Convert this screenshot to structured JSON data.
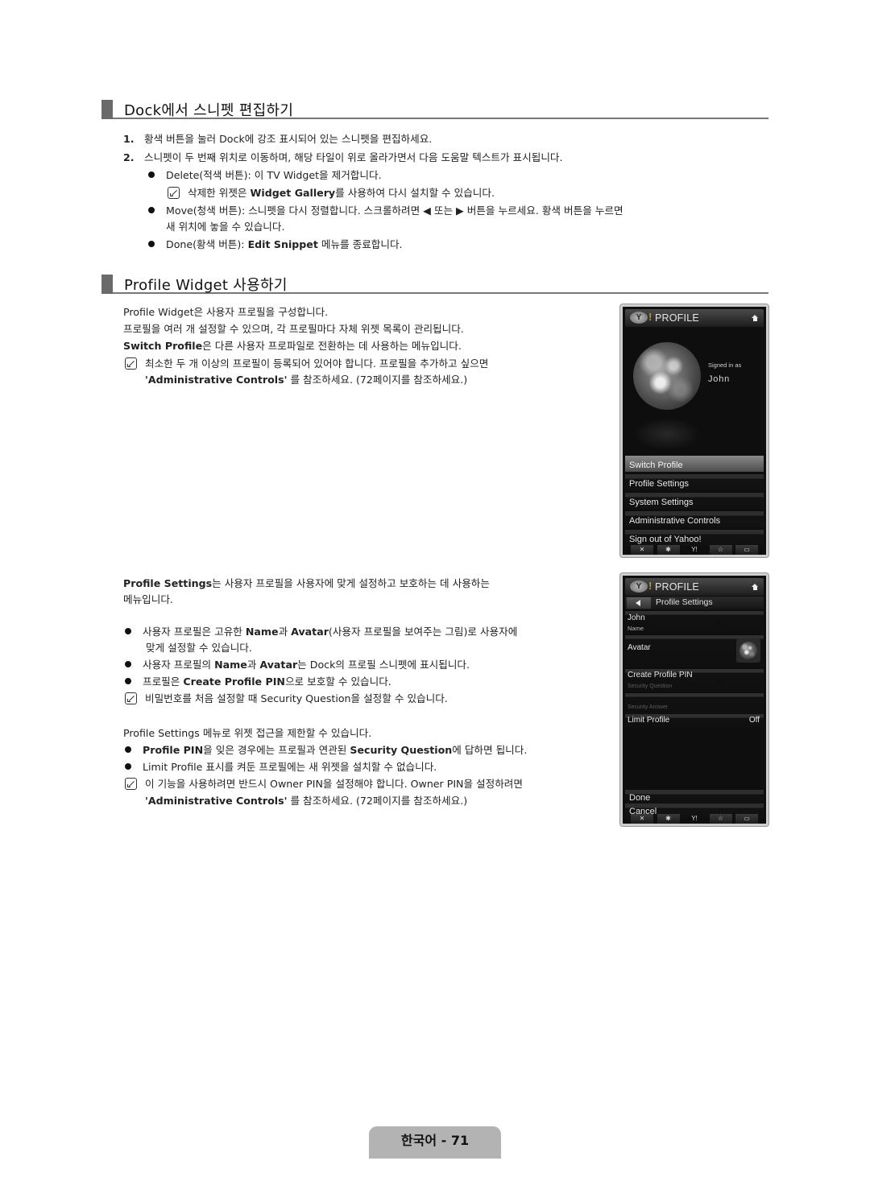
{
  "section1": {
    "title": "Dock에서 스니펫 편집하기",
    "steps": [
      {
        "num": "1.",
        "text": "황색 버튼을 눌러 Dock에 강조 표시되어 있는 스니펫을 편집하세요."
      },
      {
        "num": "2.",
        "text": "스니펫이 두 번째 위치로 이동하며, 해당 타일이 위로 올라가면서 다음 도움말 텍스트가 표시됩니다."
      }
    ],
    "bullets": {
      "delete_pre": "Delete(적색 버튼): 이 TV Widget을 제거합니다.",
      "delete_note_a": "삭제한 위젯은 ",
      "delete_note_b": "Widget Gallery",
      "delete_note_c": "를 사용하여 다시 설치할 수 있습니다.",
      "move_line1": "Move(청색 버튼): 스니펫을 다시 정렬합니다. 스크롤하려면 ◀ 또는 ▶ 버튼을 누르세요. 황색 버튼을 누르면",
      "move_line2": "새 위치에 놓을 수 있습니다.",
      "done_a": "Done(황색 버튼): ",
      "done_b": "Edit Snippet",
      "done_c": " 메뉴를 종료합니다."
    }
  },
  "section2": {
    "title": "Profile Widget 사용하기",
    "intro1": "Profile Widget은 사용자 프로필을 구성합니다.",
    "intro2": "프로필을 여러 개 설정할 수 있으며, 각 프로필마다 자체 위젯 목록이 관리됩니다.",
    "intro3_b": "Switch Profile",
    "intro3_c": "은 다른 사용자 프로파일로 전환하는 데 사용하는 메뉴입니다.",
    "note1_line1": "최소한 두 개 이상의 프로필이 등록되어 있어야 합니다. 프로필을 추가하고 싶으면",
    "note1_line2_b": "'Administrative Controls'",
    "note1_line2_c": "를 참조하세요. (72페이지를 참조하세요.)",
    "ps_intro_b": "Profile Settings",
    "ps_intro_c": "는 사용자 프로필을 사용자에 맞게 설정하고 보호하는 데 사용하는",
    "ps_intro_line2": "메뉴입니다.",
    "b1_a": "사용자 프로필은 고유한 ",
    "b1_b": "Name",
    "b1_c": "과 ",
    "b1_d": "Avatar",
    "b1_e": "(사용자 프로필을 보여주는 그림)로 사용자에",
    "b1_line2": "맞게 설정할 수 있습니다.",
    "b2_a": "사용자 프로필의 ",
    "b2_b": "Name",
    "b2_c": "과 ",
    "b2_d": "Avatar",
    "b2_e": "는 Dock의 프로필 스니펫에 표시됩니다.",
    "b3_a": "프로필은 ",
    "b3_b": "Create Profile PIN",
    "b3_c": "으로 보호할 수 있습니다.",
    "note2": "비밀번호를 처음 설정할 때 Security Question을 설정할 수 있습니다.",
    "limit_intro": "Profile Settings 메뉴로 위젯 접근을 제한할 수 있습니다.",
    "b4_a": "Profile PIN",
    "b4_b": "을 잊은 경우에는 프로필과 연관된 ",
    "b4_c": "Security Question",
    "b4_d": "에 답하면 됩니다.",
    "b5": "Limit Profile 표시를 켜둔 프로필에는 새 위젯을 설치할 수 없습니다.",
    "note3_line1": "이 기능을 사용하려면 반드시 Owner PIN을 설정해야 합니다. Owner PIN을 설정하려면",
    "note3_line2_b": "'Administrative Controls'",
    "note3_line2_c": "를 참조하세요. (72페이지를 참조하세요.)"
  },
  "widget_profile": {
    "header": "PROFILE",
    "logo": "Y",
    "signed_in_label": "Signed in as",
    "user_name": "John",
    "menu": [
      {
        "label": "Switch Profile",
        "active": true
      },
      {
        "label": "Profile Settings",
        "active": false
      },
      {
        "label": "System Settings",
        "active": false
      },
      {
        "label": "Administrative Controls",
        "active": false
      },
      {
        "label": "Sign out of Yahoo!",
        "active": false
      }
    ],
    "dock_icons": [
      "close-icon",
      "gear-icon",
      "yahoo-icon",
      "star-icon",
      "screen-icon"
    ]
  },
  "widget_settings": {
    "header": "PROFILE",
    "logo": "Y",
    "sub_title": "Profile Settings",
    "name_value": "John",
    "name_label": "Name",
    "avatar_label": "Avatar",
    "create_pin_label": "Create Profile PIN",
    "security_question": "Security Question",
    "security_answer": "Security Answer",
    "limit_profile_label": "Limit Profile",
    "limit_profile_value": "Off",
    "done_label": "Done",
    "cancel_label": "Cancel"
  },
  "dock_glyphs": {
    "close": "✕",
    "gear": "✱",
    "yahoo": "Y!",
    "star": "☆",
    "screen": "▭"
  },
  "footer": {
    "page_label": "한국어 - 71"
  }
}
